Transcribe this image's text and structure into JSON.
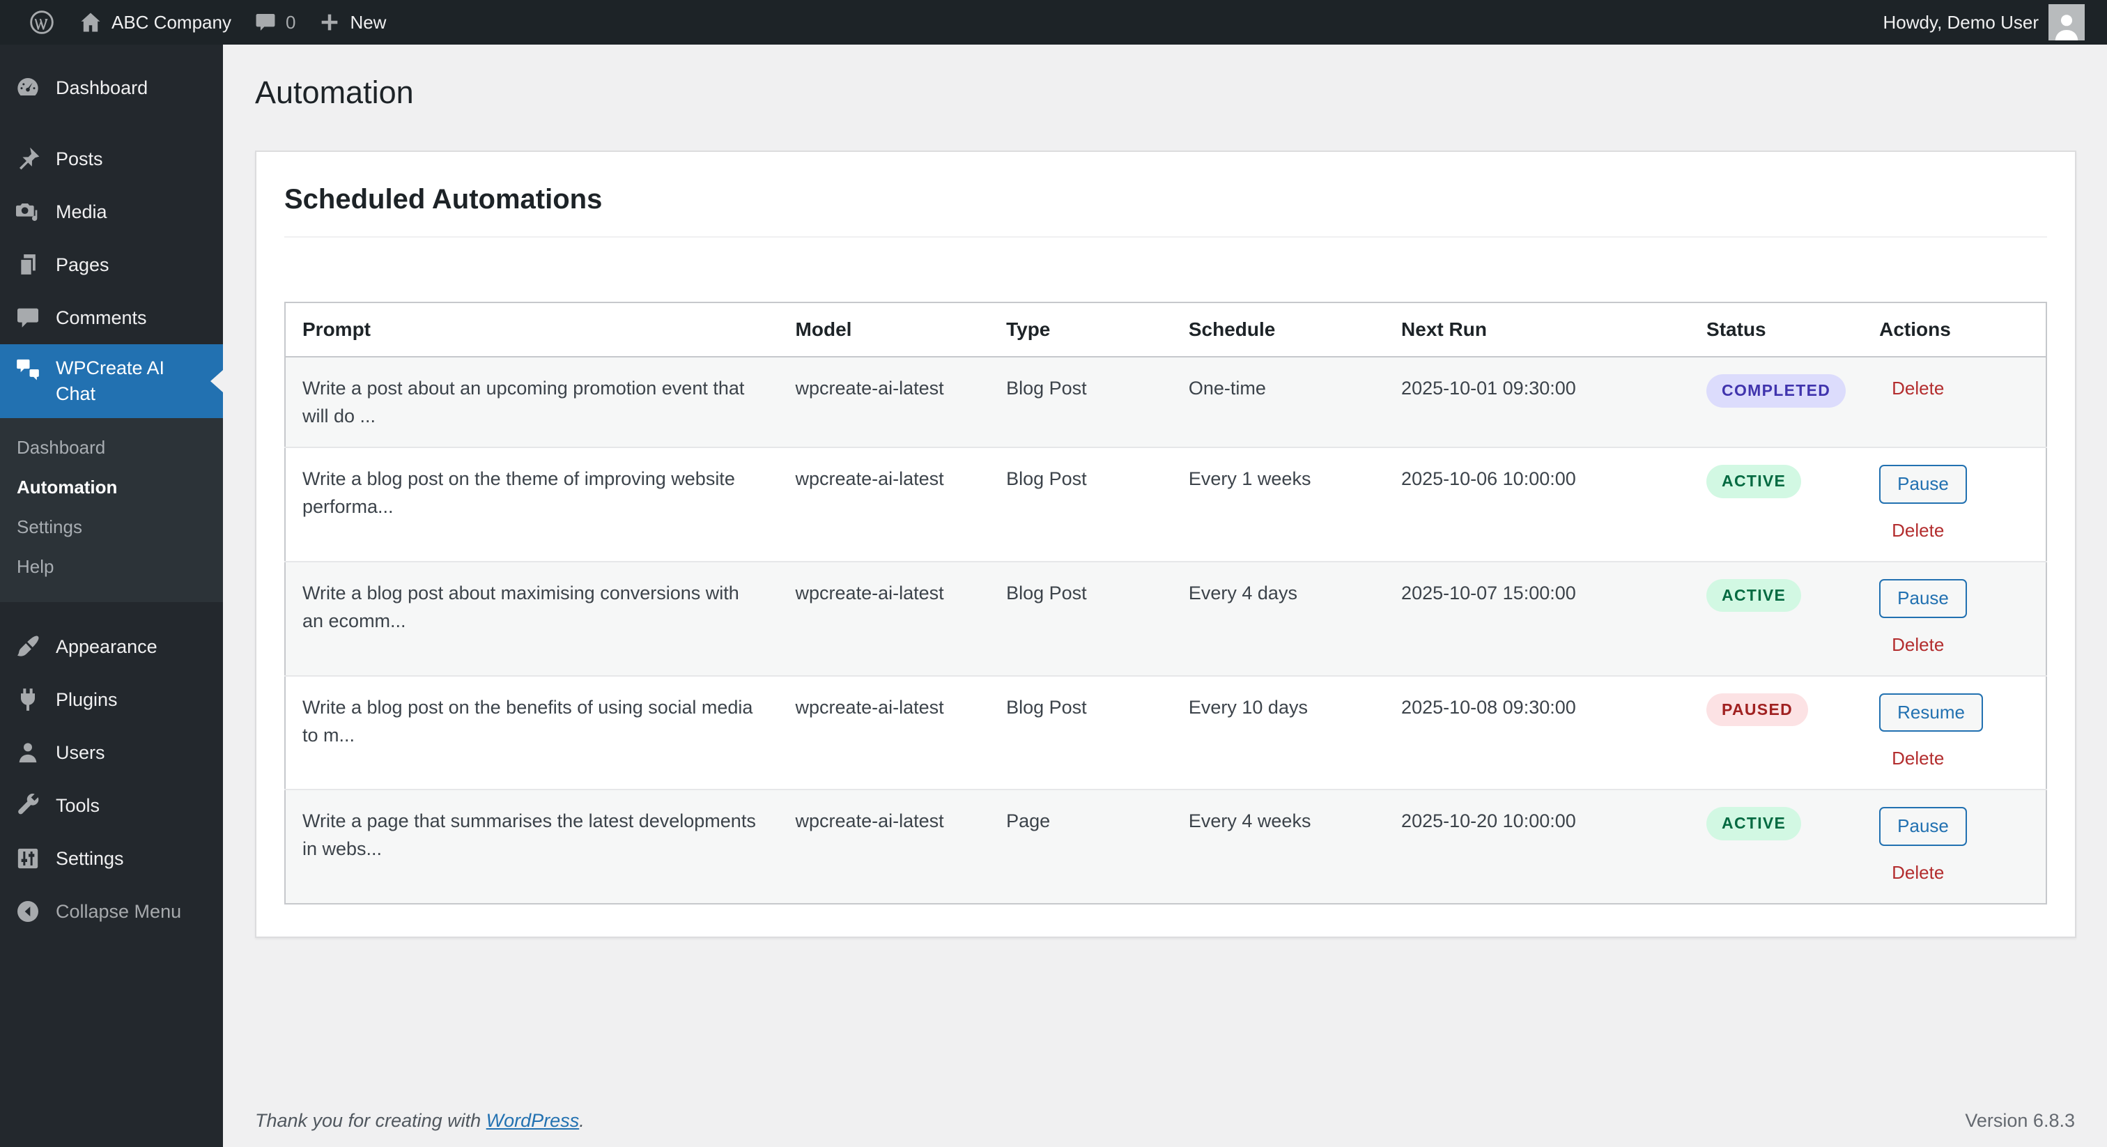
{
  "admin_bar": {
    "site_name": "ABC Company",
    "comments_count": "0",
    "new_label": "New",
    "howdy": "Howdy, Demo User",
    "icons": [
      "wordpress-logo-icon",
      "home-icon",
      "comment-bubble-icon",
      "plus-icon",
      "avatar"
    ]
  },
  "sidebar": {
    "menu_top": [
      {
        "label": "Dashboard",
        "icon": "dashboard-gauge-icon"
      },
      {
        "label": "Posts",
        "icon": "pushpin-icon"
      },
      {
        "label": "Media",
        "icon": "media-icon"
      },
      {
        "label": "Pages",
        "icon": "pages-icon"
      },
      {
        "label": "Comments",
        "icon": "comment-icon"
      }
    ],
    "wpcreate": {
      "label": "WPCreate AI Chat",
      "icon": "chat-bubbles-icon",
      "submenu": [
        {
          "label": "Dashboard",
          "current": false
        },
        {
          "label": "Automation",
          "current": true
        },
        {
          "label": "Settings",
          "current": false
        },
        {
          "label": "Help",
          "current": false
        }
      ]
    },
    "menu_bottom": [
      {
        "label": "Appearance",
        "icon": "brush-icon"
      },
      {
        "label": "Plugins",
        "icon": "plug-icon"
      },
      {
        "label": "Users",
        "icon": "user-icon"
      },
      {
        "label": "Tools",
        "icon": "wrench-icon"
      },
      {
        "label": "Settings",
        "icon": "sliders-icon"
      }
    ],
    "collapse": {
      "label": "Collapse Menu",
      "icon": "collapse-arrow-icon"
    }
  },
  "page": {
    "title": "Automation"
  },
  "card": {
    "heading": "Scheduled Automations"
  },
  "table": {
    "headers": [
      "Prompt",
      "Model",
      "Type",
      "Schedule",
      "Next Run",
      "Status",
      "Actions"
    ],
    "rows": [
      {
        "prompt": "Write a post about an upcoming promotion event that will do ...",
        "model": "wpcreate-ai-latest",
        "type": "Blog Post",
        "schedule": "One-time",
        "next_run": "2025-10-01 09:30:00",
        "status": "COMPLETED",
        "status_key": "completed",
        "toggle_action": null,
        "delete_action": "Delete"
      },
      {
        "prompt": "Write a blog post on the theme of improving website performa...",
        "model": "wpcreate-ai-latest",
        "type": "Blog Post",
        "schedule": "Every 1 weeks",
        "next_run": "2025-10-06 10:00:00",
        "status": "ACTIVE",
        "status_key": "active",
        "toggle_action": "Pause",
        "delete_action": "Delete"
      },
      {
        "prompt": "Write a blog post about maximising conversions with an ecomm...",
        "model": "wpcreate-ai-latest",
        "type": "Blog Post",
        "schedule": "Every 4 days",
        "next_run": "2025-10-07 15:00:00",
        "status": "ACTIVE",
        "status_key": "active",
        "toggle_action": "Pause",
        "delete_action": "Delete"
      },
      {
        "prompt": "Write a blog post on the benefits of using social media to m...",
        "model": "wpcreate-ai-latest",
        "type": "Blog Post",
        "schedule": "Every 10 days",
        "next_run": "2025-10-08 09:30:00",
        "status": "PAUSED",
        "status_key": "paused",
        "toggle_action": "Resume",
        "delete_action": "Delete"
      },
      {
        "prompt": "Write a page that summarises the latest developments in webs...",
        "model": "wpcreate-ai-latest",
        "type": "Page",
        "schedule": "Every 4 weeks",
        "next_run": "2025-10-20 10:00:00",
        "status": "ACTIVE",
        "status_key": "active",
        "toggle_action": "Pause",
        "delete_action": "Delete"
      }
    ]
  },
  "footer": {
    "thanks_prefix": "Thank you for creating with ",
    "wordpress_link": "WordPress",
    "thanks_suffix": ".",
    "version": "Version 6.8.3"
  },
  "colors": {
    "accent_blue": "#2271b1",
    "admin_bar_bg": "#1d2327",
    "sidebar_bg": "#23282d",
    "submenu_bg": "#2c3338",
    "page_bg": "#f0f0f1",
    "badge_completed_bg": "#dcdcfc",
    "badge_completed_text": "#4034ad",
    "badge_active_bg": "#d2f8e3",
    "badge_active_text": "#046a41",
    "badge_paused_bg": "#fce2e4",
    "badge_paused_text": "#a02121",
    "delete_red": "#b32d2e"
  }
}
